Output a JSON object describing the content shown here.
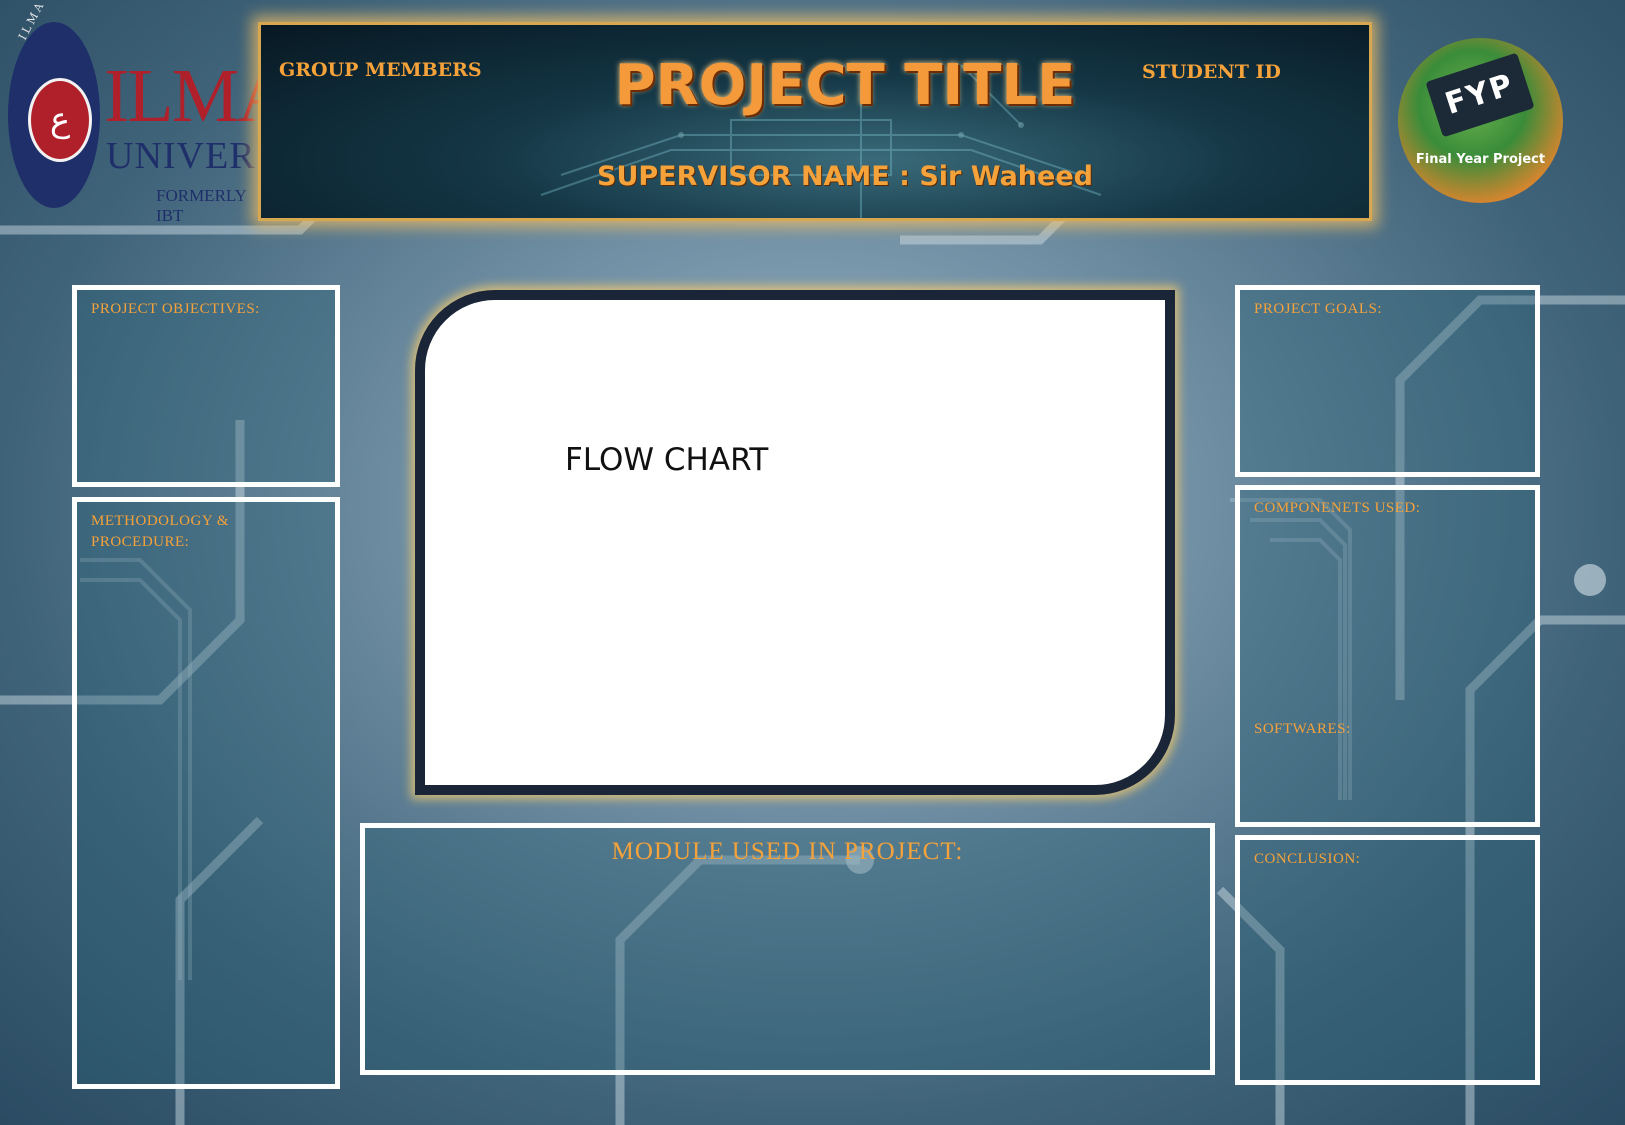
{
  "header": {
    "university_logo": {
      "ring_text": "ILMA UNIVERSITY",
      "brand": "ILMA",
      "sub": "UNIVERSITY",
      "formerly": "FORMERLY IBT",
      "emblem": "ع"
    },
    "group_members": "GROUP MEMBERS",
    "student_id": "STUDENT ID",
    "project_title": "PROJECT TITLE",
    "supervisor": "SUPERVISOR NAME : Sir Waheed",
    "fyp_logo": {
      "chip": "FYP",
      "caption": "Final Year Project"
    }
  },
  "panels": {
    "objectives": "PROJECT OBJECTIVES:",
    "methodology": "METHODOLOGY & PROCEDURE:",
    "flow_chart": "FLOW CHART",
    "module": "MODULE USED IN PROJECT:",
    "goals": "PROJECT GOALS:",
    "components": "COMPONENETS USED:",
    "softwares": "SOFTWARES:",
    "conclusion": "CONCLUSION:"
  },
  "colors": {
    "accent": "#f6a23a",
    "frame": "#ffffff",
    "navy": "#1a2638"
  }
}
